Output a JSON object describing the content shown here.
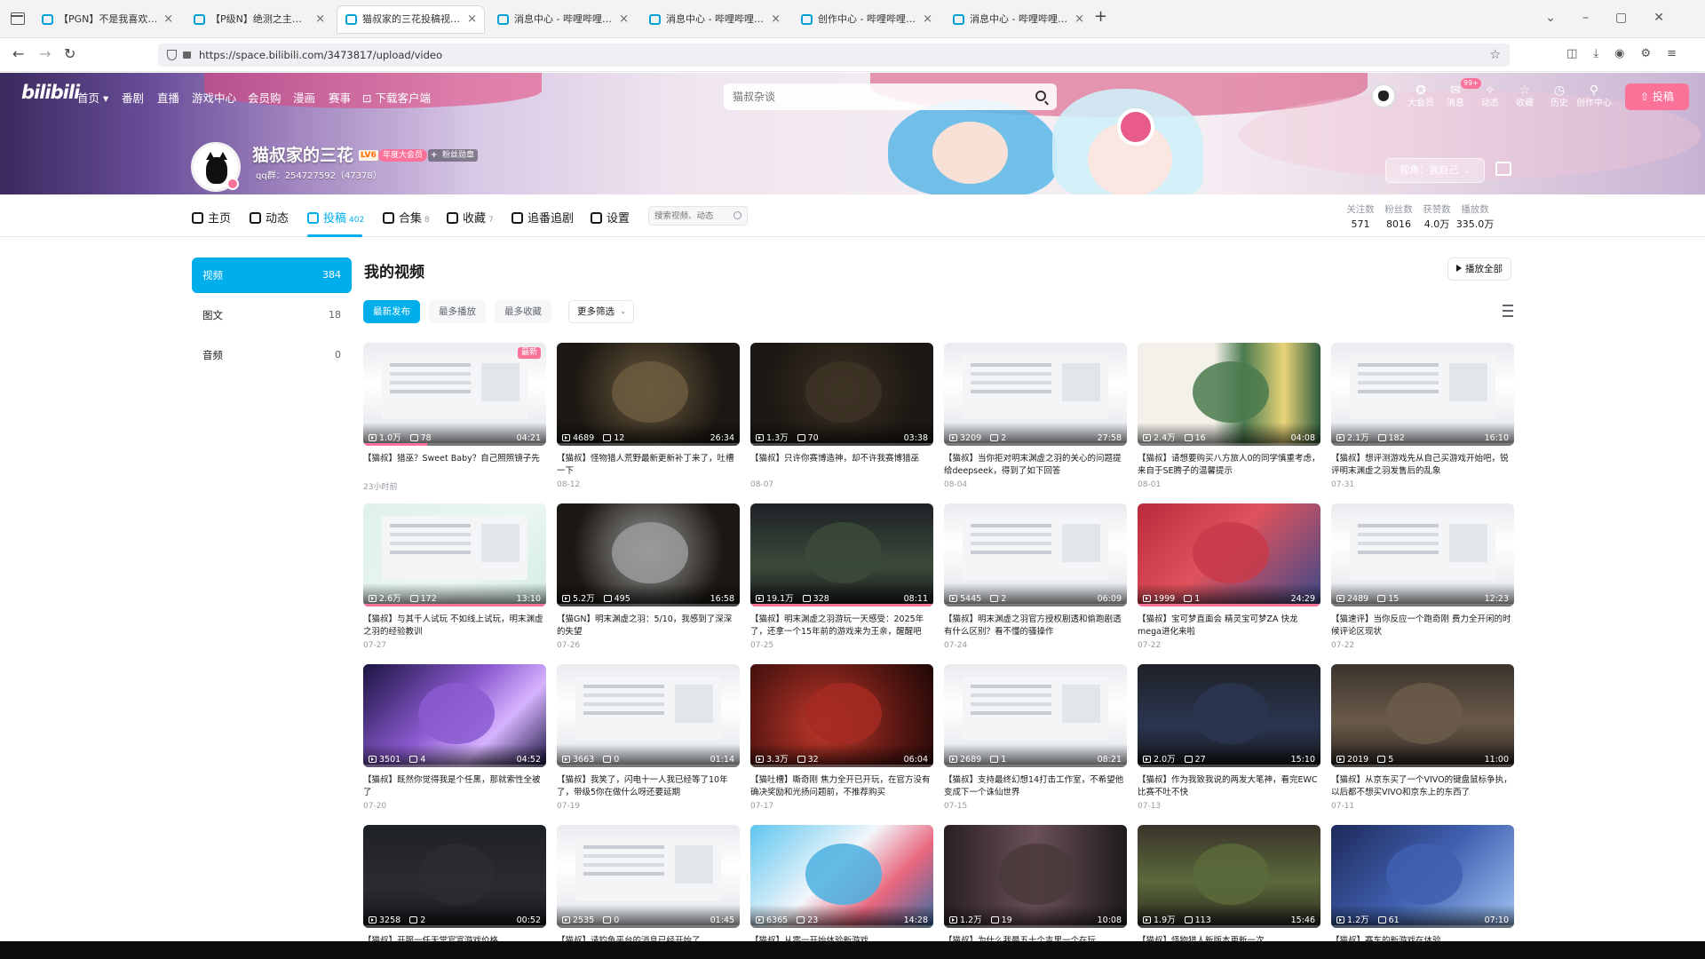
{
  "browser": {
    "tabs": [
      {
        "title": "【PGN】不是我喜欢的篇关，弄"
      },
      {
        "title": "【P级N】绝测之主！玩酱之主！"
      },
      {
        "title": "猫叔家的三花投稿视频-猫叔家"
      },
      {
        "title": "消息中心 - 哔哩哔哩弹幕视频网"
      },
      {
        "title": "消息中心 - 哔哩哔哩弹幕视频网"
      },
      {
        "title": "创作中心 - 哔哩哔哩弹幕视频网"
      },
      {
        "title": "消息中心 - 哔哩哔哩弹幕视频网"
      }
    ],
    "active_tab": 2,
    "new_tab": "+",
    "url": "https://space.bilibili.com/3473817/upload/video"
  },
  "site": {
    "logo": "bilibili",
    "nav": [
      "首页",
      "番剧",
      "直播",
      "游戏中心",
      "会员购",
      "漫画",
      "赛事",
      "下载客户端"
    ],
    "search_placeholder": "猫叔杂谈",
    "header_icons": [
      {
        "icon": "vip-icon",
        "label": "大会员"
      },
      {
        "icon": "message-icon",
        "label": "消息",
        "badge": "99+"
      },
      {
        "icon": "dynamic-icon",
        "label": "动态"
      },
      {
        "icon": "favorite-icon",
        "label": "收藏"
      },
      {
        "icon": "history-icon",
        "label": "历史"
      },
      {
        "icon": "creator-icon",
        "label": "创作中心"
      }
    ],
    "upload_label": "投稿",
    "accent": "#fb7299",
    "blue": "#00aeec"
  },
  "user": {
    "name": "猫叔家的三花",
    "level": "LV6",
    "vip": "年度大会员",
    "fan_badge": "粉丝勋章",
    "sign": "qq群：254727592（47378）",
    "perspective": "视角：我自己"
  },
  "profile_tabs": [
    {
      "label": "主页",
      "count": "",
      "icon": "home-icon"
    },
    {
      "label": "动态",
      "count": "",
      "icon": "dynamic-icon"
    },
    {
      "label": "投稿",
      "count": "402",
      "icon": "upload-icon"
    },
    {
      "label": "合集",
      "count": "8",
      "icon": "collection-icon"
    },
    {
      "label": "收藏",
      "count": "7",
      "icon": "star-icon"
    },
    {
      "label": "追番追剧",
      "count": "",
      "icon": "heart-icon"
    },
    {
      "label": "设置",
      "count": "",
      "icon": "gear-icon"
    }
  ],
  "profile_search_placeholder": "搜索视频、动态",
  "stats": [
    {
      "label": "关注数",
      "value": "571"
    },
    {
      "label": "粉丝数",
      "value": "8016"
    },
    {
      "label": "获赞数",
      "value": "4.0万"
    },
    {
      "label": "播放数",
      "value": "335.0万"
    }
  ],
  "sidebar": [
    {
      "label": "视频",
      "count": "384"
    },
    {
      "label": "图文",
      "count": "18"
    },
    {
      "label": "音频",
      "count": "0"
    }
  ],
  "main": {
    "title": "我的视频",
    "play_all": "播放全部",
    "filters": [
      "最新发布",
      "最多播放",
      "最多收藏"
    ],
    "more_filter": "更多筛选"
  },
  "videos": [
    {
      "plays": "1.0万",
      "danmaku": "78",
      "duration": "04:21",
      "title": "【猫叔】猎巫？Sweet Baby？自己照照镜子先",
      "date": "23小时前",
      "new": "最新",
      "theme": "light",
      "tint": "#e04a7a",
      "progress": 0.35
    },
    {
      "plays": "4689",
      "danmaku": "12",
      "duration": "26:34",
      "title": "【猫叔】怪物猎人荒野最新更新补丁来了，吐槽一下",
      "date": "08-12",
      "theme": "dark",
      "tint": "#6b5a3e",
      "progress": 0.0
    },
    {
      "plays": "1.3万",
      "danmaku": "70",
      "duration": "03:38",
      "title": "【猫叔】只许你赛博造神，却不许我赛博猎巫",
      "date": "08-07",
      "theme": "dark",
      "tint": "#3d3225",
      "progress": 0.0
    },
    {
      "plays": "3209",
      "danmaku": "2",
      "duration": "27:58",
      "title": "【猫叔】当你拒对明末渊虚之羽的关心的问题提给deepseek，得到了如下回答",
      "date": "08-04",
      "theme": "light",
      "tint": "#2d6fb0",
      "progress": 0.0
    },
    {
      "plays": "2.4万",
      "danmaku": "16",
      "duration": "04:08",
      "title": "【猫叔】请想要购买八方旅人0的同学慎重考虑，来自于SE腾子的温馨提示",
      "date": "08-01",
      "theme": "octopath",
      "tint": "#4a7a4e",
      "progress": 0.0
    },
    {
      "plays": "2.1万",
      "danmaku": "182",
      "duration": "16:10",
      "title": "【猫叔】想评测游戏先从自己买游戏开始吧，锐评明末渊虚之羽发售后的乱象",
      "date": "07-31",
      "theme": "light",
      "tint": "#7a5540",
      "progress": 0.0
    },
    {
      "plays": "2.6万",
      "danmaku": "172",
      "duration": "13:10",
      "title": "【猫叔】与其千人试玩 不如线上试玩，明末渊虚之羽的经验教训",
      "date": "07-27",
      "theme": "mint",
      "tint": "#d6ede6",
      "progress": 1.0
    },
    {
      "plays": "5.2万",
      "danmaku": "495",
      "duration": "16:58",
      "title": "【猫GN】明末渊虚之羽：5/10，我感到了深深的失望",
      "date": "07-26",
      "theme": "dark",
      "tint": "#9a9a9a",
      "progress": 0.0
    },
    {
      "plays": "19.1万",
      "danmaku": "328",
      "duration": "08:11",
      "title": "【猫叔】明末渊虚之羽游玩一天感受：2025年了，还拿一个15年前的游戏来为王亲，醒醒吧",
      "date": "07-25",
      "theme": "darkui",
      "tint": "#3b4a3a",
      "progress": 1.0
    },
    {
      "plays": "5445",
      "danmaku": "2",
      "duration": "06:09",
      "title": "【猫叔】明末渊虚之羽官方授权剧透和偷跑剧透有什么区别？看不懂的骚操作",
      "date": "07-24",
      "theme": "light",
      "tint": "#3a6ea5",
      "progress": 0.0
    },
    {
      "plays": "1999",
      "danmaku": "1",
      "duration": "24:29",
      "title": "【猫叔】宝可梦直面会 精灵宝可梦ZA 快龙mega进化来啦",
      "date": "07-22",
      "theme": "pokemon",
      "tint": "#c83a4a",
      "progress": 1.0
    },
    {
      "plays": "2489",
      "danmaku": "15",
      "duration": "12:23",
      "title": "【猫速评】当你反应一个跑奇刚 费力全开闲的时候评论区现状",
      "date": "07-22",
      "theme": "light",
      "tint": "#b0794a",
      "progress": 0.0
    },
    {
      "plays": "3501",
      "danmaku": "4",
      "duration": "04:52",
      "title": "【猫叔】既然你觉得我是个任黑，那就索性全被了",
      "date": "07-20",
      "theme": "anime",
      "tint": "#8b5ad0",
      "progress": 0.0
    },
    {
      "plays": "3663",
      "danmaku": "0",
      "duration": "01:14",
      "title": "【猫叔】我笑了，闪电十一人我已经等了10年了，带级5你在做什么呀还要延期",
      "date": "07-19",
      "theme": "light",
      "tint": "#d9a53a",
      "progress": 0.0
    },
    {
      "plays": "3.3万",
      "danmaku": "32",
      "duration": "06:04",
      "title": "【猫吐槽】嘶奇刚 焦力全开已开玩，在官方没有确决奖励和光扬问题前，不推荐购买",
      "date": "07-17",
      "theme": "red",
      "tint": "#a52a22",
      "progress": 0.0
    },
    {
      "plays": "2689",
      "danmaku": "1",
      "duration": "08:21",
      "title": "【猫叔】支持最终幻想14打击工作室，不希望他变成下一个诛仙世界",
      "date": "07-15",
      "theme": "light",
      "tint": "#3a7a9a",
      "progress": 0.0
    },
    {
      "plays": "2.0万",
      "danmaku": "27",
      "duration": "15:10",
      "title": "【猫叔】作为我致我说的两发大笔神，看完EWC比赛不吐不快",
      "date": "07-13",
      "theme": "darkui",
      "tint": "#2a3550",
      "progress": 0.0
    },
    {
      "plays": "2019",
      "danmaku": "5",
      "duration": "11:00",
      "title": "【猫叔】从京东买了一个VIVO的键盘鼠标争执，以后都不想买VIVO和京东上的东西了",
      "date": "07-11",
      "theme": "photo",
      "tint": "#6a5a4a",
      "progress": 0.0
    },
    {
      "plays": "3258",
      "danmaku": "2",
      "duration": "00:52",
      "title": "【猫叔】开服一任天堂官宣游戏价格",
      "date": "",
      "theme": "darkui",
      "tint": "#2b2b30",
      "progress": 0.0
    },
    {
      "plays": "2535",
      "danmaku": "0",
      "duration": "01:45",
      "title": "【猫叔】请钓鱼平台的消息已经开始了",
      "date": "",
      "theme": "light",
      "tint": "#5a4a8a",
      "progress": 0.0
    },
    {
      "plays": "6365",
      "danmaku": "23",
      "duration": "14:28",
      "title": "【猫叔】从零一开始体验新游戏",
      "date": "",
      "theme": "anime2",
      "tint": "#4ab0e0",
      "progress": 0.0
    },
    {
      "plays": "1.2万",
      "danmaku": "19",
      "duration": "10:08",
      "title": "【猫叔】为什么我最五十个吉里一个在玩",
      "date": "",
      "theme": "portrait",
      "tint": "#4a3a3a",
      "progress": 0.0
    },
    {
      "plays": "1.9万",
      "danmaku": "113",
      "duration": "15:46",
      "title": "【猫叔】怪物猎人新版本更新一次",
      "date": "",
      "theme": "photo",
      "tint": "#5a6a3a",
      "progress": 0.0
    },
    {
      "plays": "1.2万",
      "danmaku": "61",
      "duration": "07:10",
      "title": "【猫叔】赛车的新游戏在体验",
      "date": "",
      "theme": "poster",
      "tint": "#4060b0",
      "progress": 0.0
    }
  ]
}
